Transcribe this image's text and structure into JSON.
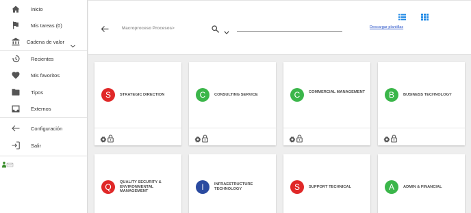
{
  "sidebar": {
    "items": [
      {
        "label": "Inicio",
        "icon": "home-icon"
      },
      {
        "label": "Mis tareas (0)",
        "icon": "flag-icon"
      },
      {
        "label": "Cadena de valor",
        "icon": "bank-icon"
      },
      {
        "label": "Recientes",
        "icon": "history-icon"
      },
      {
        "label": "Mis favoritos",
        "icon": "heart-icon"
      },
      {
        "label": "Tipos",
        "icon": "folder-icon"
      },
      {
        "label": "Externos",
        "icon": "inbox-icon"
      },
      {
        "label": "Configuración",
        "icon": "arrow-left-icon"
      },
      {
        "label": "Salir",
        "icon": "logout-icon"
      }
    ]
  },
  "header": {
    "breadcrumb": "Macroproceso Procesos>",
    "search_placeholder": "",
    "download_link": "Descargar plantillas"
  },
  "colors": {
    "red": "#e02828",
    "green": "#3bb64a",
    "blue": "#2a4aa0",
    "accent": "#1e88e5"
  },
  "cards": [
    {
      "letter": "S",
      "name": "STRATEGIC DIRECTION",
      "color": "#e02828"
    },
    {
      "letter": "C",
      "name": "CONSULTING SERVICE",
      "color": "#3bb64a"
    },
    {
      "letter": "C",
      "name": "COMMERCIAL MANAGEMENT",
      "color": "#3bb64a"
    },
    {
      "letter": "B",
      "name": "BUSINESS TECHNOLOGY",
      "color": "#3bb64a"
    },
    {
      "letter": "Q",
      "name": "QUALITY SECURITY & ENVIRONMENTAL MANAGEMENT",
      "color": "#e02828"
    },
    {
      "letter": "I",
      "name": "INFRAESTRUCTURE TECHNOLOGY",
      "color": "#2a4aa0"
    },
    {
      "letter": "S",
      "name": "SUPPORT TECHNICAL",
      "color": "#e02828"
    },
    {
      "letter": "A",
      "name": "ADMIN & FINANCIAL",
      "color": "#3bb64a"
    }
  ]
}
